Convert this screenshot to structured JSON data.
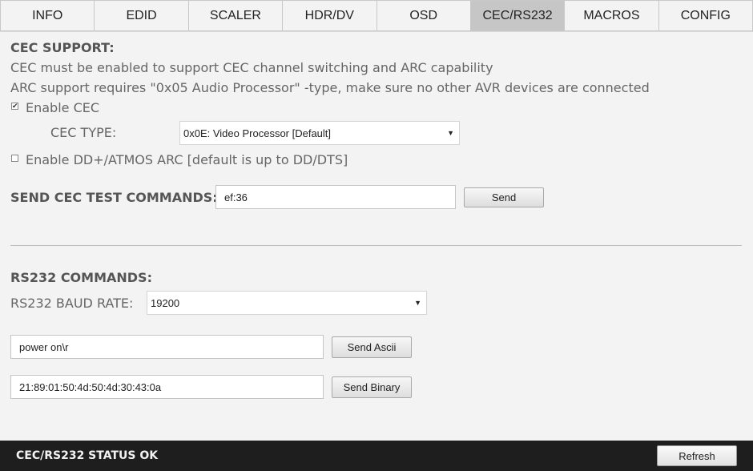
{
  "tabs": [
    {
      "label": "INFO"
    },
    {
      "label": "EDID"
    },
    {
      "label": "SCALER"
    },
    {
      "label": "HDR/DV"
    },
    {
      "label": "OSD"
    },
    {
      "label": "CEC/RS232",
      "active": true
    },
    {
      "label": "MACROS"
    },
    {
      "label": "CONFIG"
    }
  ],
  "cec": {
    "heading": "CEC SUPPORT:",
    "note1": "CEC must be enabled to support CEC channel switching and ARC capability",
    "note2": "ARC support requires \"0x05 Audio Processor\" -type, make sure no other AVR devices are connected",
    "enable_label": "Enable CEC",
    "enable_checked": true,
    "type_label": "CEC TYPE:",
    "type_value": "0x0E: Video Processor [Default]",
    "arc_label": "Enable DD+/ATMOS ARC [default is up to DD/DTS]",
    "arc_checked": false,
    "test_label": "SEND CEC TEST COMMANDS:",
    "test_value": "ef:36",
    "send_label": "Send"
  },
  "rs232": {
    "heading": "RS232 COMMANDS:",
    "baud_label": "RS232 BAUD RATE:",
    "baud_value": "19200",
    "ascii_value": "power on\\r",
    "ascii_button": "Send Ascii",
    "binary_value": "21:89:01:50:4d:50:4d:30:43:0a",
    "binary_button": "Send Binary"
  },
  "status": {
    "text": "CEC/RS232 STATUS OK",
    "refresh_label": "Refresh"
  },
  "colors": {
    "active_tab": "#c6c6c6",
    "status_bar": "#1e1e1e",
    "background": "#f3f3f3"
  },
  "icons": {
    "checkbox_checked": "check-icon",
    "dropdown": "chevron-down-icon"
  }
}
